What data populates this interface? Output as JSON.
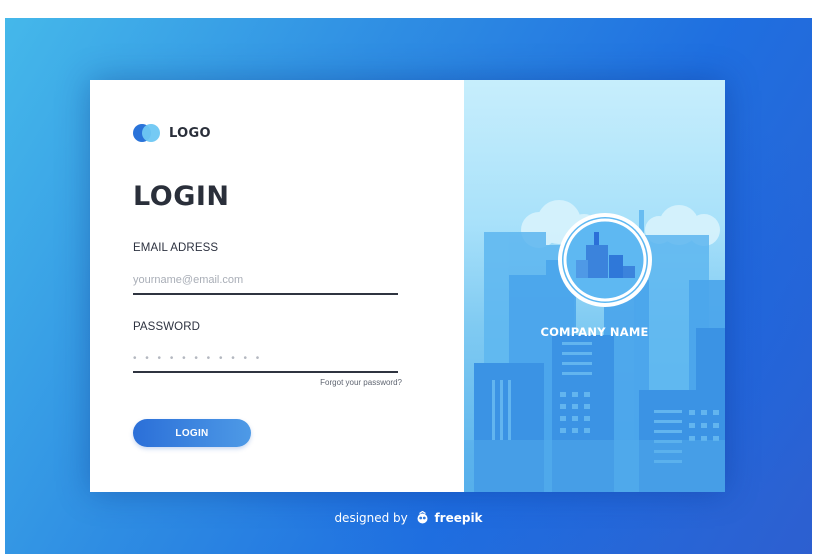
{
  "logo": {
    "text": "LOGO",
    "colors": [
      "#2a73d9",
      "#6ec7f3"
    ]
  },
  "form": {
    "title": "LOGIN",
    "email": {
      "label": "EMAIL ADRESS",
      "placeholder": "yourname@email.com",
      "value": ""
    },
    "password": {
      "label": "PASSWORD",
      "placeholder": "• • • • • • • • • • •",
      "value": ""
    },
    "forgot_link": "Forgot your password?",
    "submit_label": "LOGIN"
  },
  "illustration": {
    "company_name": "COMPANY NAME",
    "icon": "city-skyline-icon",
    "colors": {
      "sky": "#c7eefc",
      "buildings": "#3f95e6",
      "accent": "#2b6fd8"
    }
  },
  "credit": {
    "prefix": "designed by",
    "brand": "freepik",
    "icon": "freepik-icon"
  },
  "colors": {
    "background": "#2f8ee3",
    "card_left": "#ffffff",
    "text_dark": "#2a2f3a",
    "button": "#2b6fd8"
  }
}
